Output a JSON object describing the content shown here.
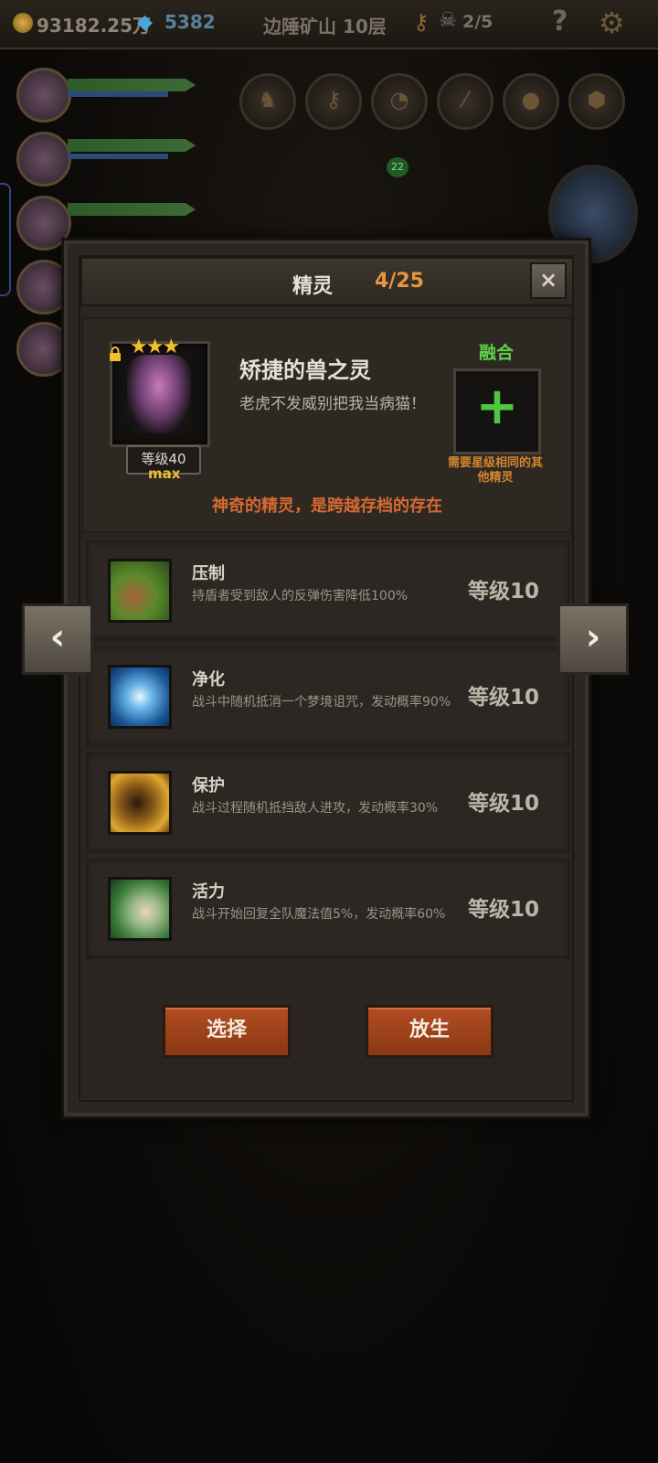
{
  "topbar": {
    "gold": "93182.25万",
    "gems": "5382",
    "location": "边陲矿山 10层",
    "skulls": "2/5",
    "help": "?"
  },
  "scene": {
    "badge": "22"
  },
  "dialog": {
    "title": "精灵",
    "count": "4/25",
    "close_icon": "×",
    "spirit": {
      "stars": "★★★",
      "level": "等级40",
      "max": "max",
      "name": "矫捷的兽之灵",
      "description": "老虎不发威别把我当病猫！",
      "fuse_label": "融合",
      "fuse_plus": "+",
      "fuse_note": "需要星级相同的其他精灵",
      "tagline": "神奇的精灵，是跨越存档的存在"
    },
    "skills": [
      {
        "name": "压制",
        "description": "持盾者受到敌人的反弹伤害降低100%",
        "level": "等级10",
        "icon": "claw-icon"
      },
      {
        "name": "净化",
        "description": "战斗中随机抵消一个梦境诅咒，发动概率90%",
        "level": "等级10",
        "icon": "flower-icon"
      },
      {
        "name": "保护",
        "description": "战斗过程随机抵挡敌人进攻，发动概率30%",
        "level": "等级10",
        "icon": "fairy-icon"
      },
      {
        "name": "活力",
        "description": "战斗开始回复全队魔法值5%，发动概率60%",
        "level": "等级10",
        "icon": "prayer-icon"
      }
    ],
    "buttons": {
      "select": "选择",
      "release": "放生"
    },
    "nav": {
      "prev": "‹",
      "next": "›"
    }
  }
}
